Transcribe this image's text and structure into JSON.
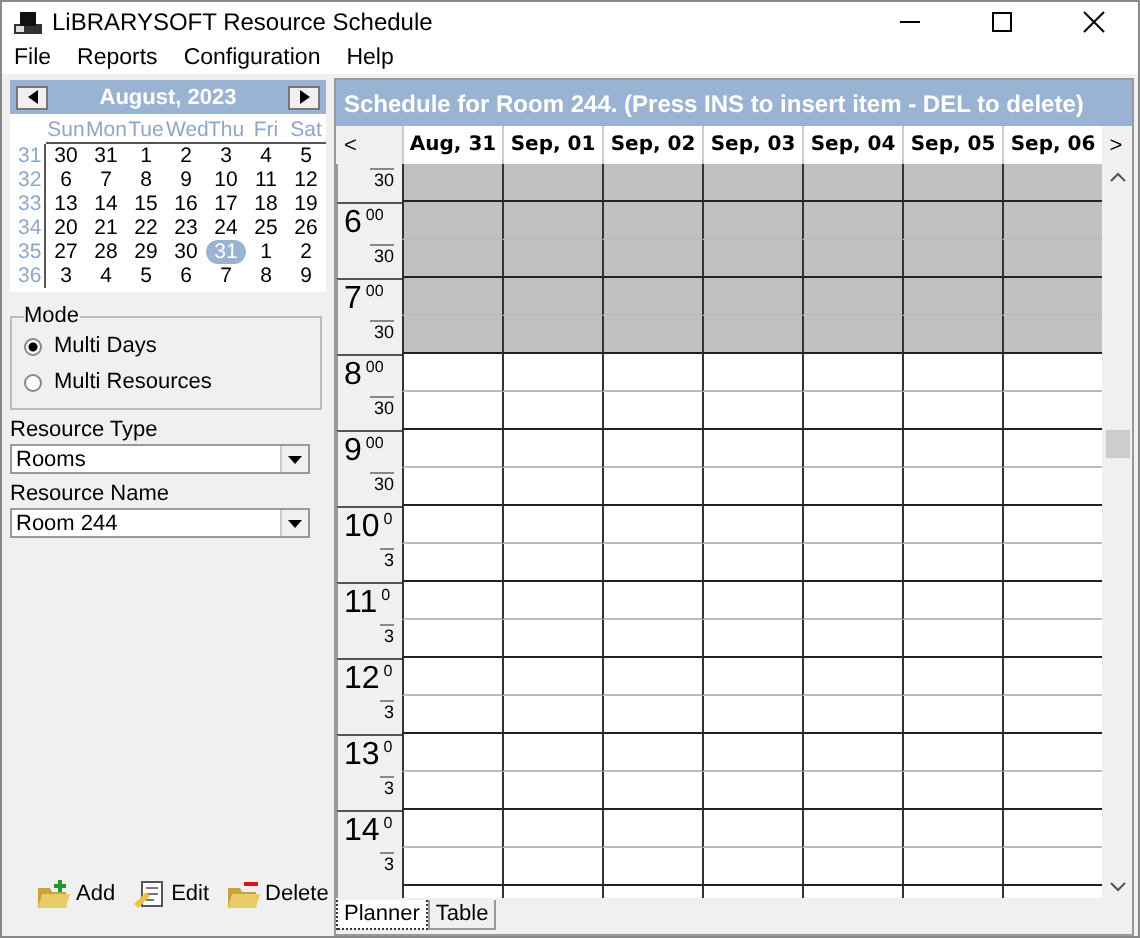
{
  "window": {
    "title": "LiBRARYSOFT Resource Schedule"
  },
  "menu": [
    "File",
    "Reports",
    "Configuration",
    "Help"
  ],
  "calendar": {
    "title": "August, 2023",
    "weekdays": [
      "Sun",
      "Mon",
      "Tue",
      "Wed",
      "Thu",
      "Fri",
      "Sat"
    ],
    "weeks": [
      {
        "number": "31",
        "days": [
          {
            "day": "30",
            "selected": false
          },
          {
            "day": "31",
            "selected": false
          },
          {
            "day": "1",
            "selected": false
          },
          {
            "day": "2",
            "selected": false
          },
          {
            "day": "3",
            "selected": false
          },
          {
            "day": "4",
            "selected": false
          },
          {
            "day": "5",
            "selected": false
          }
        ]
      },
      {
        "number": "32",
        "days": [
          {
            "day": "6",
            "selected": false
          },
          {
            "day": "7",
            "selected": false
          },
          {
            "day": "8",
            "selected": false
          },
          {
            "day": "9",
            "selected": false
          },
          {
            "day": "10",
            "selected": false
          },
          {
            "day": "11",
            "selected": false
          },
          {
            "day": "12",
            "selected": false
          }
        ]
      },
      {
        "number": "33",
        "days": [
          {
            "day": "13",
            "selected": false
          },
          {
            "day": "14",
            "selected": false
          },
          {
            "day": "15",
            "selected": false
          },
          {
            "day": "16",
            "selected": false
          },
          {
            "day": "17",
            "selected": false
          },
          {
            "day": "18",
            "selected": false
          },
          {
            "day": "19",
            "selected": false
          }
        ]
      },
      {
        "number": "34",
        "days": [
          {
            "day": "20",
            "selected": false
          },
          {
            "day": "21",
            "selected": false
          },
          {
            "day": "22",
            "selected": false
          },
          {
            "day": "23",
            "selected": false
          },
          {
            "day": "24",
            "selected": false
          },
          {
            "day": "25",
            "selected": false
          },
          {
            "day": "26",
            "selected": false
          }
        ]
      },
      {
        "number": "35",
        "days": [
          {
            "day": "27",
            "selected": false
          },
          {
            "day": "28",
            "selected": false
          },
          {
            "day": "29",
            "selected": false
          },
          {
            "day": "30",
            "selected": false
          },
          {
            "day": "31",
            "selected": true
          },
          {
            "day": "1",
            "selected": false
          },
          {
            "day": "2",
            "selected": false
          }
        ]
      },
      {
        "number": "36",
        "days": [
          {
            "day": "3",
            "selected": false
          },
          {
            "day": "4",
            "selected": false
          },
          {
            "day": "5",
            "selected": false
          },
          {
            "day": "6",
            "selected": false
          },
          {
            "day": "7",
            "selected": false
          },
          {
            "day": "8",
            "selected": false
          },
          {
            "day": "9",
            "selected": false
          }
        ]
      }
    ]
  },
  "mode": {
    "label": "Mode",
    "options": [
      {
        "label": "Multi Days",
        "selected": true
      },
      {
        "label": "Multi Resources",
        "selected": false
      }
    ]
  },
  "resource_type": {
    "label": "Resource Type",
    "value": "Rooms"
  },
  "resource_name": {
    "label": "Resource Name",
    "value": "Room 244"
  },
  "actions": [
    {
      "kind": "add",
      "label": "Add"
    },
    {
      "kind": "edit",
      "label": "Edit"
    },
    {
      "kind": "delete",
      "label": "Delete"
    }
  ],
  "schedule": {
    "title": "Schedule for Room 244. (Press INS to insert item - DEL to delete)",
    "prev": "<",
    "next": ">",
    "days": [
      "Aug, 31",
      "Sep, 01",
      "Sep, 02",
      "Sep, 03",
      "Sep, 04",
      "Sep, 05",
      "Sep, 06"
    ],
    "rows": [
      {
        "kind": "half",
        "minutes": "30",
        "blocked": true
      },
      {
        "kind": "hour",
        "hour": "6",
        "minutes": "00",
        "blocked": true
      },
      {
        "kind": "half",
        "minutes": "30",
        "blocked": true
      },
      {
        "kind": "hour",
        "hour": "7",
        "minutes": "00",
        "blocked": true
      },
      {
        "kind": "half",
        "minutes": "30",
        "blocked": true
      },
      {
        "kind": "hour",
        "hour": "8",
        "minutes": "00",
        "blocked": false
      },
      {
        "kind": "half",
        "minutes": "30",
        "blocked": false
      },
      {
        "kind": "hour",
        "hour": "9",
        "minutes": "00",
        "blocked": false
      },
      {
        "kind": "half",
        "minutes": "30",
        "blocked": false
      },
      {
        "kind": "hour",
        "hour": "10",
        "minutes": "0",
        "blocked": false
      },
      {
        "kind": "half",
        "minutes": "3",
        "blocked": false
      },
      {
        "kind": "hour",
        "hour": "11",
        "minutes": "0",
        "blocked": false
      },
      {
        "kind": "half",
        "minutes": "3",
        "blocked": false
      },
      {
        "kind": "hour",
        "hour": "12",
        "minutes": "0",
        "blocked": false
      },
      {
        "kind": "half",
        "minutes": "3",
        "blocked": false
      },
      {
        "kind": "hour",
        "hour": "13",
        "minutes": "0",
        "blocked": false
      },
      {
        "kind": "half",
        "minutes": "3",
        "blocked": false
      },
      {
        "kind": "hour",
        "hour": "14",
        "minutes": "0",
        "blocked": false
      },
      {
        "kind": "half",
        "minutes": "3",
        "blocked": false
      }
    ]
  },
  "tabs": [
    {
      "label": "Planner",
      "selected": true
    },
    {
      "label": "Table",
      "selected": false
    }
  ]
}
